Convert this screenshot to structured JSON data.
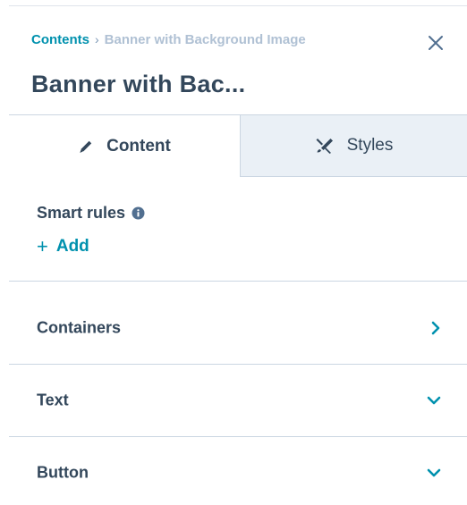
{
  "header": {
    "breadcrumb": {
      "root": "Contents",
      "separator": "›",
      "current": "Banner with Background Image"
    },
    "title": "Banner with Bac..."
  },
  "tabs": [
    {
      "label": "Content",
      "icon": "pencil-icon",
      "active": true
    },
    {
      "label": "Styles",
      "icon": "paintbrush-icon",
      "active": false
    }
  ],
  "smart_rules": {
    "title": "Smart rules",
    "add_label": "Add",
    "add_symbol": "+"
  },
  "sections": [
    {
      "label": "Containers",
      "icon": "chevron-right-icon"
    },
    {
      "label": "Text",
      "icon": "chevron-down-icon"
    },
    {
      "label": "Button",
      "icon": "chevron-down-icon"
    }
  ],
  "colors": {
    "link": "#0091ae",
    "text": "#33475b",
    "muted": "#b0c1d4",
    "inactive_tab_bg": "#eaf0f6",
    "border": "#cbd6e2"
  }
}
